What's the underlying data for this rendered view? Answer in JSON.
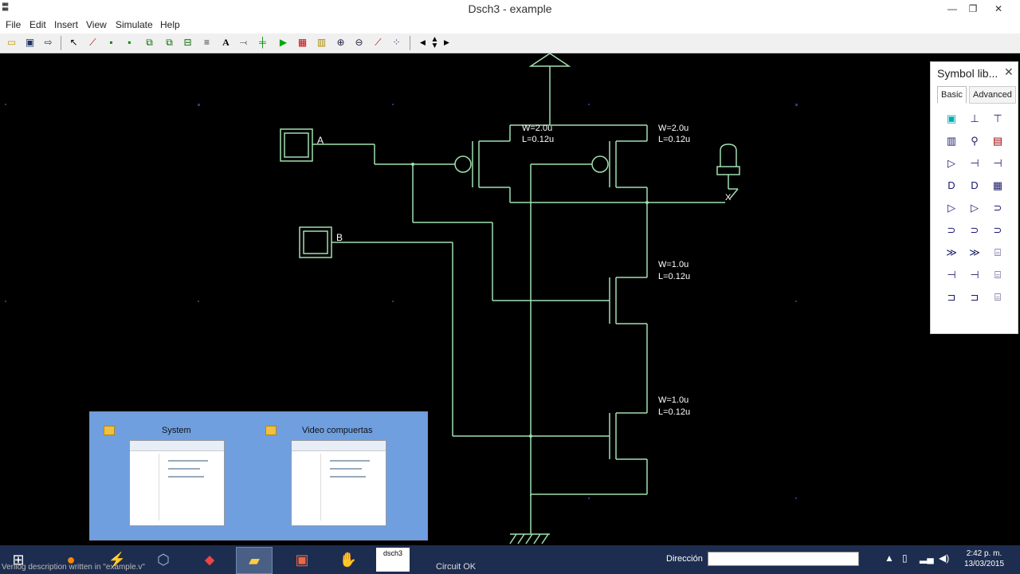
{
  "window": {
    "title": "Dsch3 - example",
    "app_icon": "dsch3-app-icon",
    "controls": {
      "minimize": "—",
      "maximize": "❐",
      "close": "✕"
    }
  },
  "menu": [
    "File",
    "Edit",
    "Insert",
    "View",
    "Simulate",
    "Help"
  ],
  "toolbar_icons": [
    "open-icon",
    "save-icon",
    "export-icon",
    "pointer-icon",
    "line-icon",
    "connect-icon",
    "move-icon",
    "copy-icon",
    "delete-icon",
    "rotate-icon",
    "text-icon",
    "probe-icon",
    "node-icon",
    "simulate-icon",
    "timing-icon",
    "chronogram-icon",
    "zoom-in-icon",
    "zoom-out-icon",
    "extract-icon",
    "grid-icon",
    "left-arrow-icon",
    "up-down-arrow-icon",
    "right-arrow-icon"
  ],
  "schematic": {
    "inputs": [
      {
        "label": "A"
      },
      {
        "label": "B"
      }
    ],
    "output": {
      "label": "X"
    },
    "transistors": [
      {
        "w": "W=2.0u",
        "l": "L=0.12u"
      },
      {
        "w": "W=2.0u",
        "l": "L=0.12u"
      },
      {
        "w": "W=1.0u",
        "l": "L=0.12u"
      },
      {
        "w": "W=1.0u",
        "l": "L=0.12u"
      }
    ],
    "colors": {
      "wire": "#9fe0b0",
      "symbol": "#6fdf6f",
      "background": "#000000",
      "grid_dot": "#2a3a7a"
    }
  },
  "symbol_library": {
    "title": "Symbol lib...",
    "close": "✕",
    "tabs": [
      "Basic",
      "Advanced"
    ],
    "active_tab": "Basic",
    "icons": [
      "button-icon",
      "vdd-icon",
      "ground-icon",
      "clock-icon",
      "light-icon",
      "display-icon",
      "buffer-icon",
      "nmos-icon",
      "pmos-icon",
      "and-icon",
      "nand-icon",
      "keyboard-icon",
      "or-icon",
      "nor-icon",
      "xor-icon",
      "xnor-icon",
      "inverter-icon",
      "or3-icon",
      "schmitt-icon",
      "tri-icon",
      "latch-icon",
      "resistor-icon",
      "capacitor-icon",
      "dff-icon",
      "mux-icon",
      "adder-icon",
      "counter-icon"
    ]
  },
  "taskbar_preview": {
    "windows": [
      {
        "title": "System"
      },
      {
        "title": "Video compuertas"
      }
    ]
  },
  "taskbar": {
    "apps": [
      "windows-start-icon",
      "firefox-icon",
      "schematic-app-icon",
      "virtualbox-icon",
      "media-icon",
      "file-explorer-icon",
      "powerpoint-icon",
      "paint-glove-icon",
      "dsch3-taskbar-icon"
    ],
    "dsch3_label": "dsch3",
    "status_overlay": "Verilog description written in \"example.v\"",
    "circuit_status": "Circuit OK",
    "address_label": "Dirección",
    "address_value": "",
    "clock_time": "2:42 p. m.",
    "clock_date": "13/03/2015"
  }
}
